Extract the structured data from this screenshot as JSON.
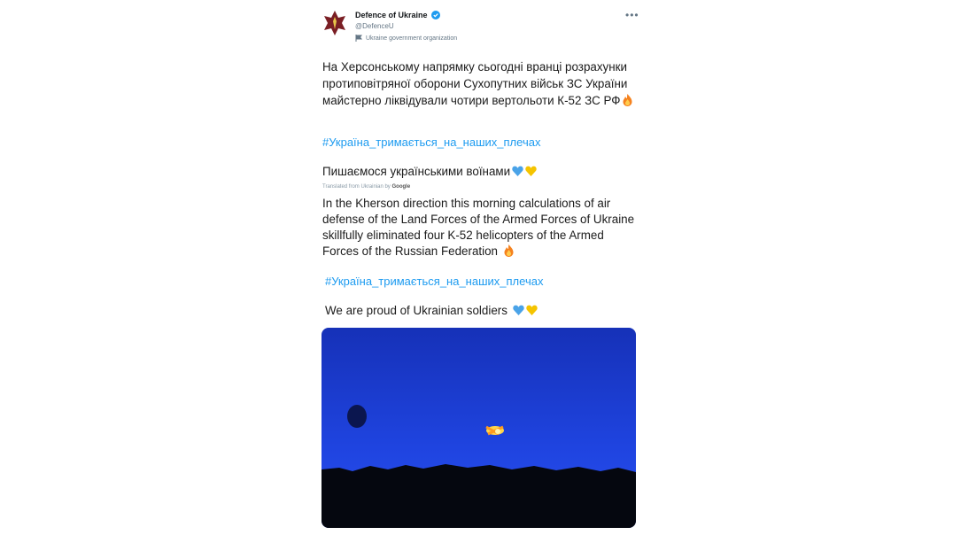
{
  "account": {
    "display_name": "Defence of Ukraine",
    "handle": "@DefenceU",
    "org_label": "Ukraine government organization",
    "avatar_icon": "ukraine-defence-emblem-icon",
    "verified_icon": "verified-badge-icon",
    "more_icon": "more-options-icon"
  },
  "tweet": {
    "uk_text": "На Херсонському напрямку сьогодні вранці розрахунки протиповітряної оборони Сухопутних військ ЗС України майстерно ліквідували чотири вертольоти К-52 ЗС РФ",
    "uk_hashtag": "#Україна_тримається_на_наших_плечах",
    "uk_proud": "Пишаємося українськими воїнами",
    "translated_label": "Translated from Ukrainian by",
    "translated_provider": "Google",
    "en_text": "In the Kherson direction this morning calculations of air defense of the Land Forces of the Armed Forces of Ukraine skillfully eliminated four K-52 helicopters of the Armed Forces of the Russian Federation",
    "en_hashtag": "#Україна_тримається_на_наших_плечах",
    "en_proud": "We are proud of Ukrainian soldiers"
  },
  "colors": {
    "link": "#1d9bf0",
    "sky": "#1e3fd8",
    "heart_blue": "#4aa3e8",
    "heart_yellow": "#f5c400"
  }
}
